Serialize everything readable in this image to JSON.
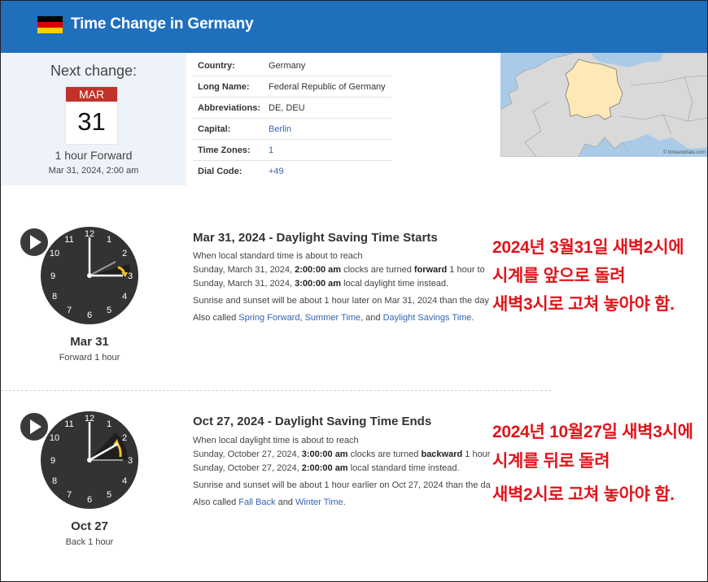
{
  "header": {
    "title": "Time Change  in Germany"
  },
  "next_change": {
    "label": "Next change:",
    "month": "MAR",
    "day": "31",
    "description": "1 hour Forward",
    "datetime": "Mar 31, 2024, 2:00 am"
  },
  "info": [
    {
      "key": "Country:",
      "value": "Germany",
      "link": false
    },
    {
      "key": "Long Name:",
      "value": "Federal Republic of Germany",
      "link": false
    },
    {
      "key": "Abbreviations:",
      "value": "DE, DEU",
      "link": false
    },
    {
      "key": "Capital:",
      "value": "Berlin",
      "link": true
    },
    {
      "key": "Time Zones:",
      "value": "1",
      "link": true
    },
    {
      "key": "Dial Code:",
      "value": "+49",
      "link": true
    }
  ],
  "map": {
    "credit": "© timeanddate.com"
  },
  "clock_numbers": [
    "12",
    "1",
    "2",
    "3",
    "4",
    "5",
    "6",
    "7",
    "8",
    "9",
    "10",
    "11"
  ],
  "events": [
    {
      "clock_date": "Mar 31",
      "clock_sub": "Forward 1 hour",
      "title": "Mar 31, 2024 - Daylight Saving Time Starts",
      "l1": "When local standard time is about to reach",
      "l2a": "Sunday, March 31, 2024, ",
      "l2b": "2:00:00 am",
      "l2c": " clocks are turned ",
      "l2d": "forward",
      "l2e": " 1 hour to",
      "l3a": "Sunday, March 31, 2024, ",
      "l3b": "3:00:00 am",
      "l3c": " local daylight time instead.",
      "l4": "Sunrise and sunset will be about 1 hour later on Mar 31, 2024 than the day",
      "also_prefix": "Also called ",
      "also": [
        "Spring Forward",
        "Summer Time",
        "Daylight Savings Time"
      ],
      "also_seps": [
        ", ",
        ", and ",
        "."
      ],
      "note": [
        "2024년 3월31일 새벽2시에",
        "시계를 앞으로 돌려",
        "새벽3시로 고쳐 놓아야 함."
      ]
    },
    {
      "clock_date": "Oct 27",
      "clock_sub": "Back 1 hour",
      "title": "Oct 27, 2024 - Daylight Saving Time Ends",
      "l1": "When local daylight time is about to reach",
      "l2a": "Sunday, October 27, 2024, ",
      "l2b": "3:00:00 am",
      "l2c": " clocks are turned ",
      "l2d": "backward",
      "l2e": " 1 hour",
      "l3a": "Sunday, October 27, 2024, ",
      "l3b": "2:00:00 am",
      "l3c": " local standard time instead.",
      "l4": "Sunrise and sunset will be about 1 hour earlier on Oct 27, 2024 than the da",
      "also_prefix": "Also called ",
      "also": [
        "Fall Back",
        "Winter Time"
      ],
      "also_seps": [
        " and ",
        "."
      ],
      "note": [
        "2024년 10월27일 새벽3시에",
        "시계를 뒤로 돌려",
        "새벽2시로 고쳐 놓아야 함."
      ]
    }
  ],
  "colors": {
    "header": "#1f6fbd",
    "note": "#e0151b",
    "link": "#3464b3",
    "calendar": "#c0322a",
    "germany": "#fde8b8"
  }
}
